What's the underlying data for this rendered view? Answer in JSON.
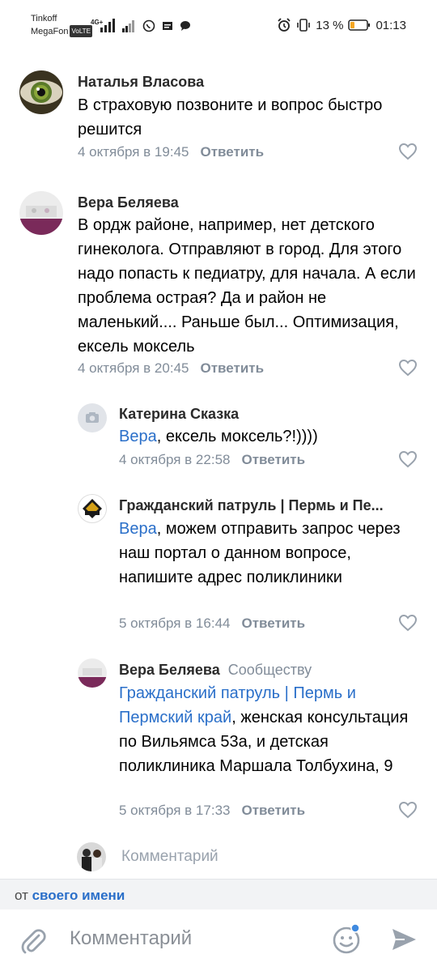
{
  "status_bar": {
    "carrier_1": "Tinkoff",
    "carrier_2": "MegaFon",
    "volte": "VoLTE",
    "network": "4G+",
    "battery": "13 %",
    "time": "01:13"
  },
  "comments": [
    {
      "author": "Наталья Власова",
      "text": "В страховую позвоните и вопрос быстро решится",
      "date": "4 октября в 19:45",
      "reply": "Ответить"
    },
    {
      "author": "Вера Беляева",
      "text": "В ордж районе, например, нет детского гинеколога. Отправляют в город. Для этого надо попасть к педиатру, для начала. А если проблема острая? Да и район не маленький.... Раньше был... Оптимизация, ексель моксель",
      "date": "4 октября в 20:45",
      "reply": "Ответить"
    },
    {
      "author": "Катерина Сказка",
      "mention": "Вера",
      "text": ", ексель моксель?!))))",
      "date": "4 октября в 22:58",
      "reply": "Ответить"
    },
    {
      "author": "Гражданский патруль | Пермь и Пе...",
      "mention": "Вера",
      "text": ", можем отправить запрос через наш портал о данном вопросе, напишите адрес поликлиники",
      "date": "5 октября в 16:44",
      "reply": "Ответить"
    },
    {
      "author": "Вера Беляева",
      "tag": "Сообществу",
      "mention": "Гражданский патруль | Пермь и Пермский край",
      "text": ", женская консультация по Вильямса 53а, и детская поликлиника Маршала Толбухина, 9",
      "date": "5 октября в 17:33",
      "reply": "Ответить"
    }
  ],
  "inline_comment": {
    "placeholder": "Комментарий"
  },
  "from_bar": {
    "prefix": "от ",
    "link": "своего имени"
  },
  "composer": {
    "placeholder": "Комментарий"
  },
  "colors": {
    "link": "#2a6fc9",
    "meta": "#818c99",
    "send": "#99a2ad",
    "notify_dot": "#3f8ae0"
  },
  "icons": [
    "alarm-icon",
    "vibrate-icon",
    "battery-icon",
    "heart-icon",
    "camera-icon",
    "paperclip-icon",
    "emoji-icon",
    "send-icon"
  ]
}
